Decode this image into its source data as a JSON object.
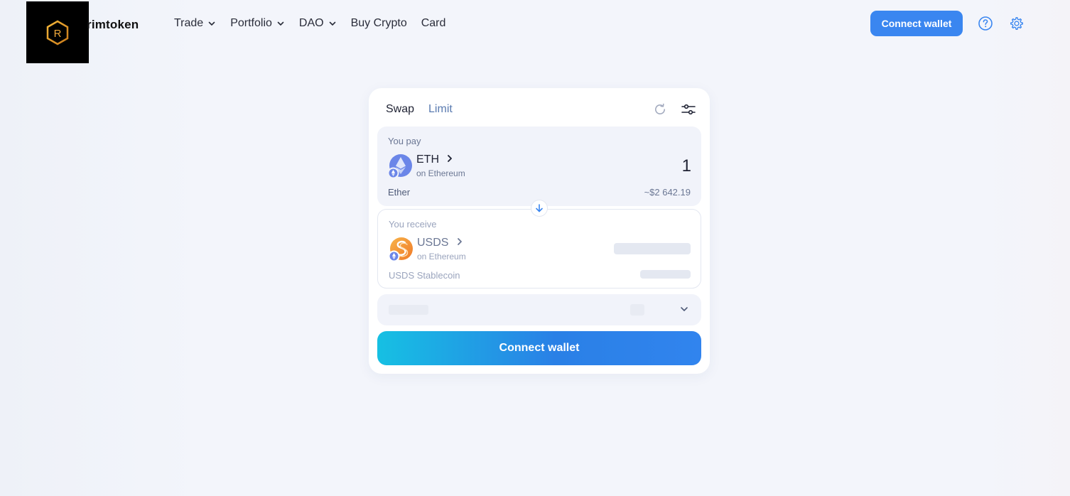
{
  "brand": {
    "name": "rimtoken",
    "logo_letter": "R"
  },
  "nav": {
    "items": [
      {
        "label": "Trade",
        "dropdown": true
      },
      {
        "label": "Portfolio",
        "dropdown": true
      },
      {
        "label": "DAO",
        "dropdown": true
      },
      {
        "label": "Buy Crypto",
        "dropdown": false
      },
      {
        "label": "Card",
        "dropdown": false
      }
    ]
  },
  "header": {
    "connect_label": "Connect wallet"
  },
  "swap": {
    "tabs": [
      {
        "label": "Swap",
        "active": true
      },
      {
        "label": "Limit",
        "active": false
      }
    ],
    "pay": {
      "label": "You pay",
      "symbol": "ETH",
      "network": "on Ethereum",
      "amount": "1",
      "token_name": "Ether",
      "usd_value": "~$2 642.19"
    },
    "receive": {
      "label": "You receive",
      "symbol": "USDS",
      "network": "on Ethereum",
      "token_name": "USDS Stablecoin"
    },
    "connect_label": "Connect wallet"
  },
  "colors": {
    "accent": "#3a86f0",
    "gradient_start": "#16c0e3",
    "gradient_end": "#3184ee",
    "background": "#f3f5fb"
  }
}
